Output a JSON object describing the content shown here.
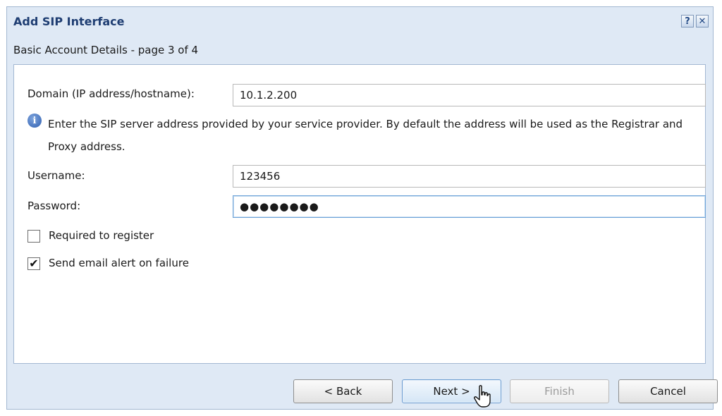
{
  "window": {
    "title": "Add SIP Interface",
    "help_icon": "question-icon",
    "close_icon": "close-icon"
  },
  "subtitle": "Basic Account Details - page 3 of 4",
  "form": {
    "domain_label": "Domain (IP address/hostname):",
    "domain_value": "10.1.2.200",
    "info_icon": "info-icon",
    "info_text": "Enter the SIP server address provided by your service provider. By default the address will be used as the Registrar and Proxy address.",
    "username_label": "Username:",
    "username_value": "123456",
    "password_label": "Password:",
    "password_masked": "●●●●●●●●",
    "required_label": "Required to register",
    "required_checked": false,
    "alert_label": "Send email alert on failure",
    "alert_checked": true
  },
  "buttons": {
    "back": "< Back",
    "next": "Next >",
    "finish": "Finish",
    "cancel": "Cancel"
  },
  "cursor_icon": "hand-pointer-icon"
}
